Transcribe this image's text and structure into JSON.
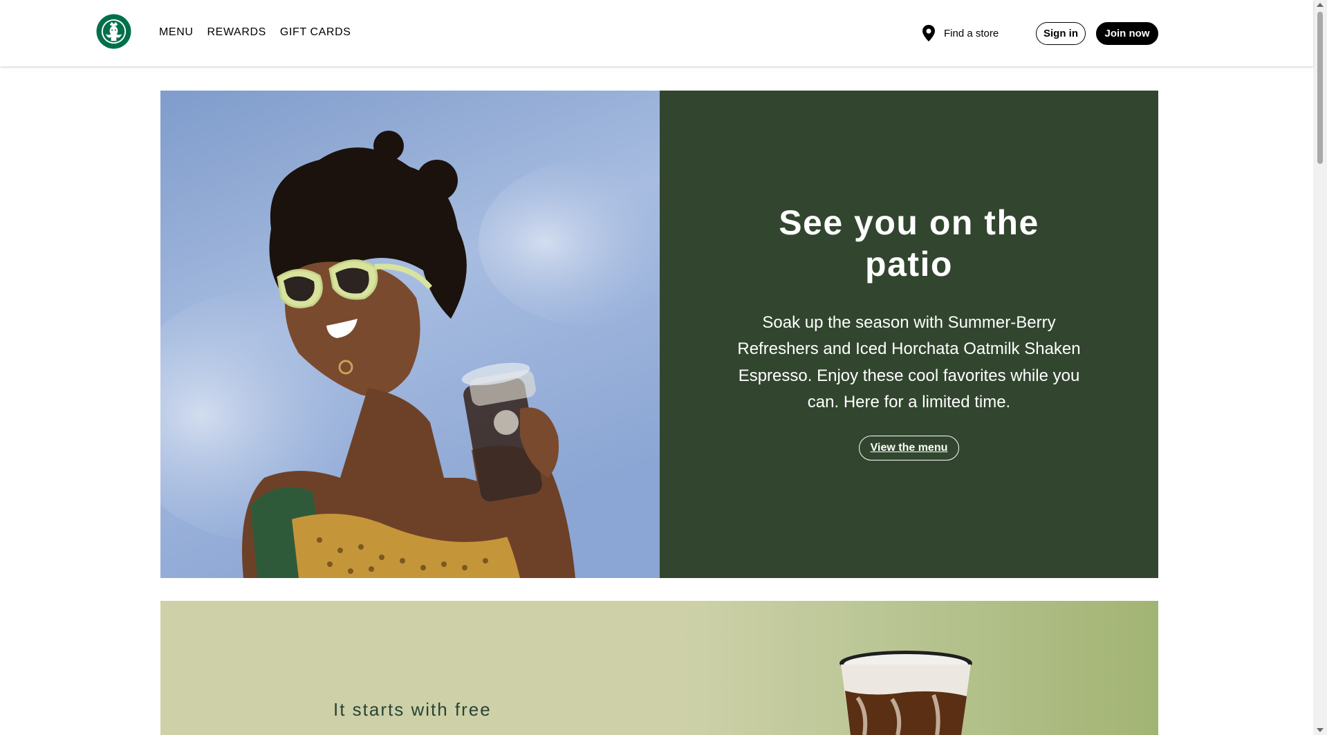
{
  "header": {
    "nav": [
      "MENU",
      "REWARDS",
      "GIFT CARDS"
    ],
    "find_store": "Find a store",
    "sign_in": "Sign in",
    "join_now": "Join now"
  },
  "hero": {
    "title": "See you on the patio",
    "body": "Soak up the season with Summer-Berry Refreshers and Iced Horchata Oatmilk Shaken Espresso. Enjoy these cool favorites while you can. Here for a limited time.",
    "cta": "View the menu"
  },
  "band": {
    "title": "It starts with free"
  },
  "colors": {
    "brand_green": "#00704a",
    "hero_panel": "#32462f",
    "band_bg": "#ced1a8"
  },
  "icons": {
    "logo": "starbucks-siren-logo",
    "find_store": "location-pin-icon"
  }
}
